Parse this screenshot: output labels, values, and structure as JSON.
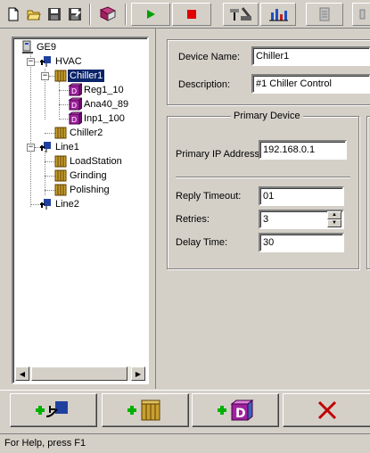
{
  "toolbar": {
    "icons": [
      "new-file-icon",
      "open-folder-icon",
      "save-icon",
      "save-as-icon",
      "book-icon",
      "run-icon",
      "stop-icon",
      "tools-icon",
      "chart-icon",
      "report-icon"
    ]
  },
  "tree": {
    "root": "GE9",
    "nodes": {
      "hvac": "HVAC",
      "chiller1": "Chiller1",
      "reg": "Reg1_10",
      "ana": "Ana40_89",
      "inp": "Inp1_100",
      "chiller2": "Chiller2",
      "line1": "Line1",
      "loadstation": "LoadStation",
      "grinding": "Grinding",
      "polishing": "Polishing",
      "line2": "Line2"
    }
  },
  "device": {
    "name_label": "Device Name:",
    "name_value": "Chiller1",
    "desc_label": "Description:",
    "desc_value": "#1 Chiller Control"
  },
  "primary": {
    "title": "Primary Device",
    "ip_label": "Primary IP Address",
    "ip_value": "192.168.0.1",
    "reply_label": "Reply Timeout:",
    "reply_value": "01",
    "retries_label": "Retries:",
    "retries_value": "3",
    "delay_label": "Delay Time:",
    "delay_value": "30"
  },
  "status": {
    "text": "For Help, press F1"
  },
  "colors": {
    "face": "#d4d0c8",
    "selection": "#0a246a",
    "run_green": "#00a000",
    "stop_red": "#e00000",
    "add_green": "#00b000",
    "delete_red": "#c00000"
  }
}
